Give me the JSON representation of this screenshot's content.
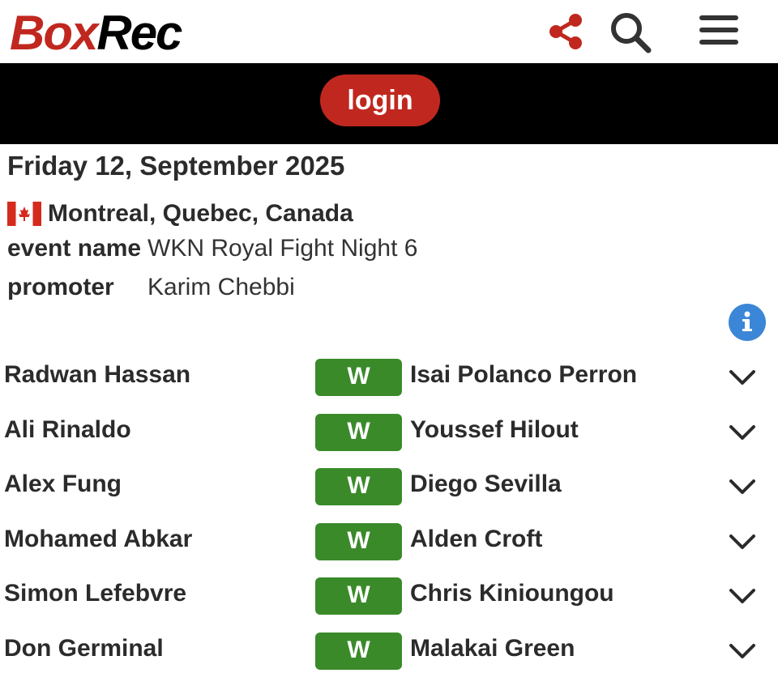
{
  "header": {
    "logo_part1": "Box",
    "logo_part2": "Rec",
    "share_icon": "share-icon",
    "search_icon": "search-icon",
    "menu_icon": "hamburger-menu-icon"
  },
  "login": {
    "label": "login"
  },
  "event": {
    "date": "Friday 12, September 2025",
    "flag_icon": "canada-flag-icon",
    "location": "Montreal, Quebec, Canada",
    "event_name_label": "event name",
    "event_name": "WKN Royal Fight Night 6",
    "promoter_label": "promoter",
    "promoter": "Karim Chebbi"
  },
  "colors": {
    "brand_red": "#c0281f",
    "win_green": "#3a8a2a",
    "info_blue": "#3b86d6",
    "bar_black": "#000000"
  },
  "bouts": [
    {
      "fighter1": "Radwan Hassan",
      "result": "W",
      "fighter2": "Isai Polanco Perron"
    },
    {
      "fighter1": "Ali Rinaldo",
      "result": "W",
      "fighter2": "Youssef Hilout"
    },
    {
      "fighter1": "Alex Fung",
      "result": "W",
      "fighter2": "Diego Sevilla"
    },
    {
      "fighter1": "Mohamed Abkar",
      "result": "W",
      "fighter2": "Alden Croft"
    },
    {
      "fighter1": "Simon Lefebvre",
      "result": "W",
      "fighter2": "Chris Kinioungou"
    },
    {
      "fighter1": "Don Germinal",
      "result": "W",
      "fighter2": "Malakai Green"
    }
  ]
}
